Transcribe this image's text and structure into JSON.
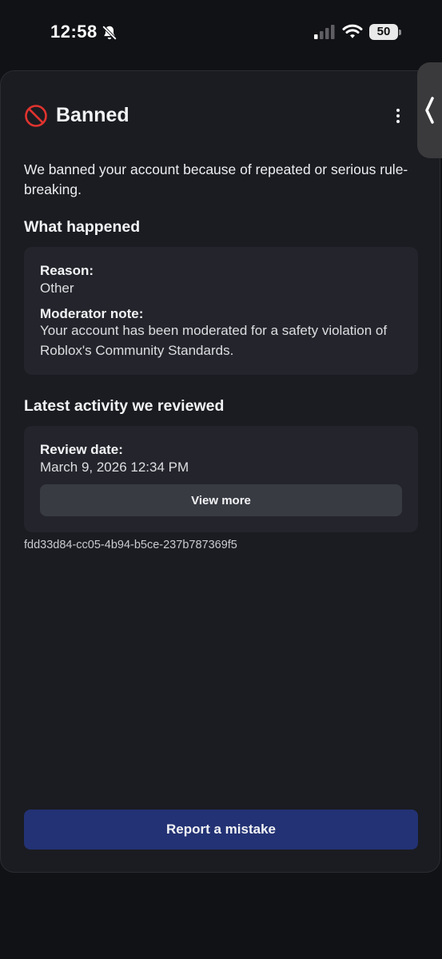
{
  "status_bar": {
    "time": "12:58",
    "battery_level": "50",
    "icons": [
      "bell-off-icon",
      "cellular-signal-icon",
      "wifi-icon",
      "battery-icon"
    ]
  },
  "sheet": {
    "edge_tab_icon": "chevron-left-icon",
    "title_icon": "ban-icon",
    "title": "Banned",
    "menu_icon": "more-vertical-icon",
    "description": "We banned your account because of repeated or serious rule-breaking.",
    "what_happened": {
      "heading": "What happened",
      "reason_label": "Reason:",
      "reason_value": "Other",
      "note_label": "Moderator note:",
      "note_value": "Your account has been moderated for a safety violation of Roblox's Community Standards."
    },
    "latest_activity": {
      "heading": "Latest activity we reviewed",
      "review_date_label": "Review date:",
      "review_date_value": "March 9, 2026 12:34 PM",
      "view_more_label": "View more"
    },
    "reference_id": "fdd33d84-cc05-4b94-b5ce-237b787369f5",
    "report_button_label": "Report a mistake"
  },
  "colors": {
    "background": "#111216",
    "sheet": "#1b1c21",
    "card": "#24252c",
    "secondary_button": "#393b43",
    "primary_button": "#233274",
    "ban_icon": "#e0332f"
  }
}
